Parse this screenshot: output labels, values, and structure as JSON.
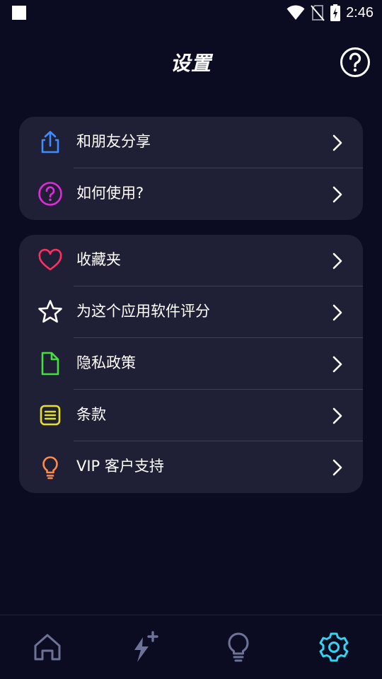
{
  "status_bar": {
    "time": "2:46"
  },
  "header": {
    "title": "设置"
  },
  "colors": {
    "background": "#0b0c22",
    "card": "#1f2035",
    "divider": "#3d3e58",
    "accent_active": "#33d4f0",
    "nav_inactive": "#6e7296"
  },
  "groups": [
    {
      "items": [
        {
          "label": "和朋友分享",
          "icon": "share-icon",
          "color": "#3f8cff"
        },
        {
          "label": "如何使用?",
          "icon": "question-circle-icon",
          "color": "#e22ad8"
        }
      ]
    },
    {
      "items": [
        {
          "label": "收藏夹",
          "icon": "heart-icon",
          "color": "#ff2f63"
        },
        {
          "label": "为这个应用软件评分",
          "icon": "star-icon",
          "color": "#ffffff"
        },
        {
          "label": "隐私政策",
          "icon": "document-icon",
          "color": "#44e040"
        },
        {
          "label": "条款",
          "icon": "list-icon",
          "color": "#e6df2a"
        },
        {
          "label": "VIP 客户支持",
          "icon": "lightbulb-icon",
          "color": "#ff8a4c"
        }
      ]
    }
  ],
  "bottom_nav": {
    "items": [
      {
        "name": "home",
        "icon": "home-icon",
        "active": false
      },
      {
        "name": "boost",
        "icon": "bolt-plus-icon",
        "active": false
      },
      {
        "name": "tips",
        "icon": "lightbulb-icon",
        "active": false
      },
      {
        "name": "settings",
        "icon": "gear-icon",
        "active": true
      }
    ]
  }
}
